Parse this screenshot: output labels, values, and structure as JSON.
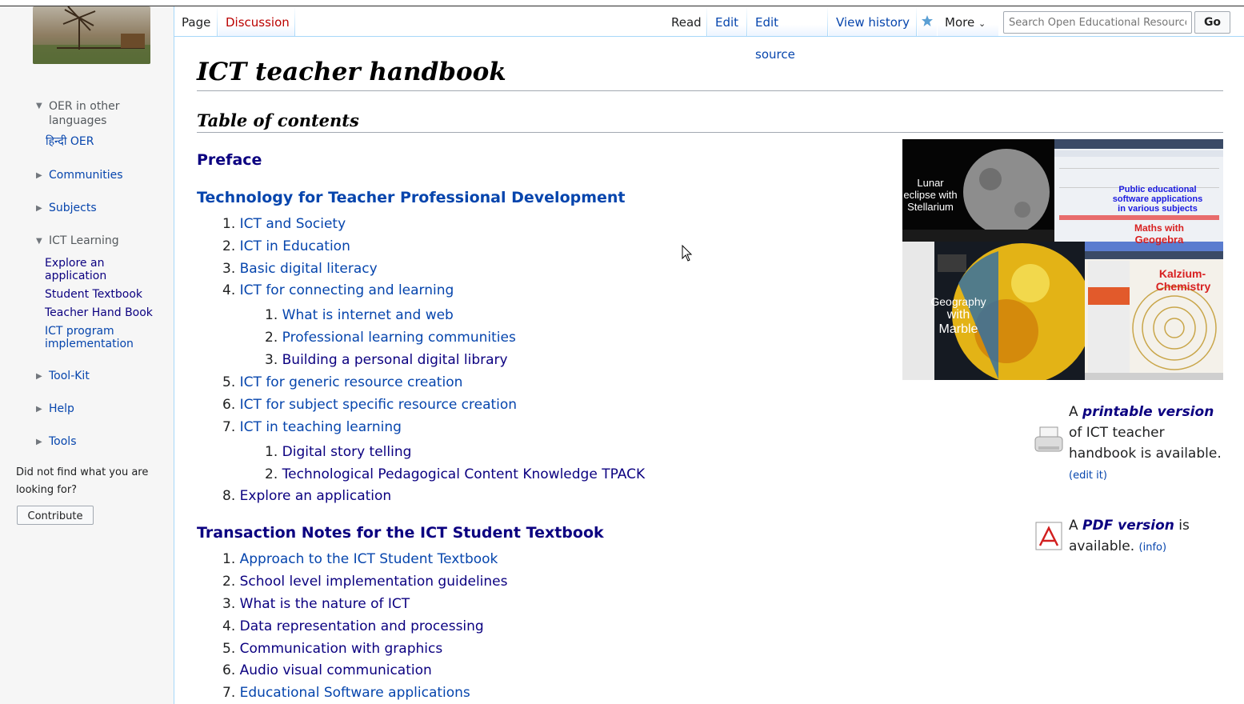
{
  "tabs": {
    "page": "Page",
    "discussion": "Discussion",
    "read": "Read",
    "edit": "Edit",
    "edit_source": "Edit source",
    "view_history": "View history",
    "more": "More",
    "watch_icon": "star-icon"
  },
  "search": {
    "placeholder": "Search Open Educational Resource",
    "go_label": "Go"
  },
  "sidebar": {
    "languages_head": "OER in other languages",
    "languages_link": "हिन्दी OER",
    "communities": "Communities",
    "subjects": "Subjects",
    "ict_learning": "ICT Learning",
    "ict_items": [
      "Explore an application",
      "Student Textbook",
      "Teacher Hand Book",
      "ICT program implementation"
    ],
    "toolkit": "Tool-Kit",
    "help": "Help",
    "tools": "Tools",
    "note": "Did not find what you are looking for?",
    "contribute": "Contribute"
  },
  "page": {
    "title": "ICT teacher handbook",
    "toc_heading": "Table of contents",
    "preface": "Preface",
    "section1": {
      "title": "Technology for Teacher Professional Development",
      "items": [
        {
          "n": "1.",
          "label": "ICT and Society"
        },
        {
          "n": "2.",
          "label": "ICT in Education"
        },
        {
          "n": "3.",
          "label": "Basic digital literacy"
        },
        {
          "n": "4.",
          "label": "ICT for connecting and learning"
        },
        {
          "n": "1.",
          "label": "What is internet and web"
        },
        {
          "n": "2.",
          "label": "Professional learning communities"
        },
        {
          "n": "3.",
          "label": "Building a personal digital library"
        },
        {
          "n": "5.",
          "label": "ICT for generic resource creation"
        },
        {
          "n": "6.",
          "label": "ICT for subject specific resource creation"
        },
        {
          "n": "7.",
          "label": "ICT in teaching learning"
        },
        {
          "n": "1.",
          "label": "Digital story telling"
        },
        {
          "n": "2.",
          "label": "Technological Pedagogical Content Knowledge TPACK"
        },
        {
          "n": "8.",
          "label": "Explore an application"
        }
      ]
    },
    "section2": {
      "title": "Transaction Notes for the ICT Student Textbook",
      "items": [
        {
          "n": "1.",
          "label": "Approach to the ICT Student Textbook"
        },
        {
          "n": "2.",
          "label": "School level implementation guidelines"
        },
        {
          "n": "3.",
          "label": "What is the nature of ICT"
        },
        {
          "n": "4.",
          "label": "Data representation and processing"
        },
        {
          "n": "5.",
          "label": "Communication with graphics"
        },
        {
          "n": "6.",
          "label": "Audio visual communication"
        },
        {
          "n": "7.",
          "label": "Educational Software applications"
        }
      ]
    },
    "collage": {
      "lunar": [
        "Lunar",
        "eclipse with",
        "Stellarium"
      ],
      "public": [
        "Public educational",
        "software applications",
        "in various subjects"
      ],
      "maths": [
        "Maths with",
        "Geogebra"
      ],
      "geo": [
        "Geography",
        "with",
        "Marble"
      ],
      "kalzium": [
        "Kalzium-",
        "Chemistry"
      ]
    },
    "printable": {
      "prefix": "A",
      "link": "printable version",
      "rest": "of ICT teacher handbook is available.",
      "edit": "(edit it)"
    },
    "pdf": {
      "prefix": "A",
      "link": "PDF version",
      "rest": "is available.",
      "info": "(info)"
    }
  }
}
